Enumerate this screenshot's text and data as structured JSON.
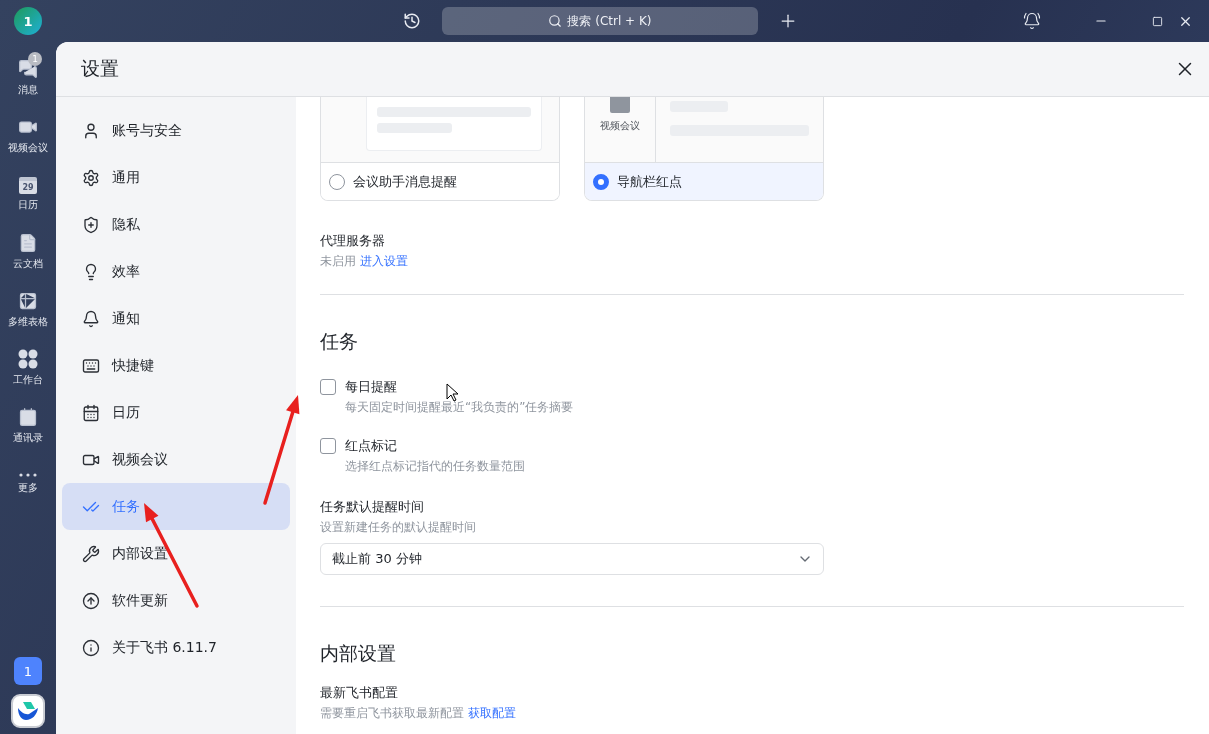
{
  "rail": {
    "avatar": "1",
    "items": [
      {
        "label": "消息",
        "badge": "1"
      },
      {
        "label": "视频会议"
      },
      {
        "label": "日历",
        "icon_text": "29"
      },
      {
        "label": "云文档"
      },
      {
        "label": "多维表格"
      },
      {
        "label": "工作台"
      },
      {
        "label": "通讯录"
      },
      {
        "label": "更多"
      }
    ],
    "bottom_badge": "1"
  },
  "top_bar": {
    "search": {
      "placeholder": "搜索 (Ctrl + K)"
    }
  },
  "settings": {
    "title": "设置",
    "nav": [
      {
        "label": "账号与安全",
        "selected": false
      },
      {
        "label": "通用",
        "selected": false
      },
      {
        "label": "隐私",
        "selected": false
      },
      {
        "label": "效率",
        "selected": false
      },
      {
        "label": "通知",
        "selected": false
      },
      {
        "label": "快捷键",
        "selected": false
      },
      {
        "label": "日历",
        "selected": false
      },
      {
        "label": "视频会议",
        "selected": false
      },
      {
        "label": "任务",
        "selected": true
      },
      {
        "label": "内部设置",
        "selected": false
      },
      {
        "label": "软件更新",
        "selected": false
      },
      {
        "label": "关于飞书 6.11.7",
        "selected": false
      }
    ],
    "reminder_options": [
      {
        "kind": "assistant",
        "label": "会议助手消息提醒",
        "selected": false
      },
      {
        "kind": "navbar",
        "label": "导航栏红点",
        "preview_label": "视频会议",
        "selected": true
      }
    ],
    "proxy": {
      "title": "代理服务器",
      "status": "未启用",
      "link": "进入设置"
    },
    "tasks": {
      "heading": "任务",
      "options": [
        {
          "label": "每日提醒",
          "description": "每天固定时间提醒最近“我负责的”任务摘要",
          "checked": false
        },
        {
          "label": "红点标记",
          "description": "选择红点标记指代的任务数量范围",
          "checked": false
        }
      ],
      "default_time": {
        "label": "任务默认提醒时间",
        "description": "设置新建任务的默认提醒时间",
        "value": "截止前 30 分钟"
      }
    },
    "internal": {
      "heading": "内部设置",
      "title": "最新飞书配置",
      "description": "需要重启飞书获取最新配置",
      "link": "获取配置"
    }
  }
}
